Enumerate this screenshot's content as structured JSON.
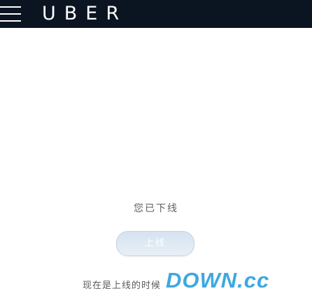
{
  "header": {
    "logo_text": "UBER",
    "menu_icon": "hamburger-menu-icon",
    "background_color": "#0b1521"
  },
  "main": {
    "title": "您已下线",
    "button_label": "上线",
    "status_text": "现在是上线的时候"
  },
  "watermark": {
    "text": "DOWN.cc",
    "color": "#3ea8e0"
  }
}
